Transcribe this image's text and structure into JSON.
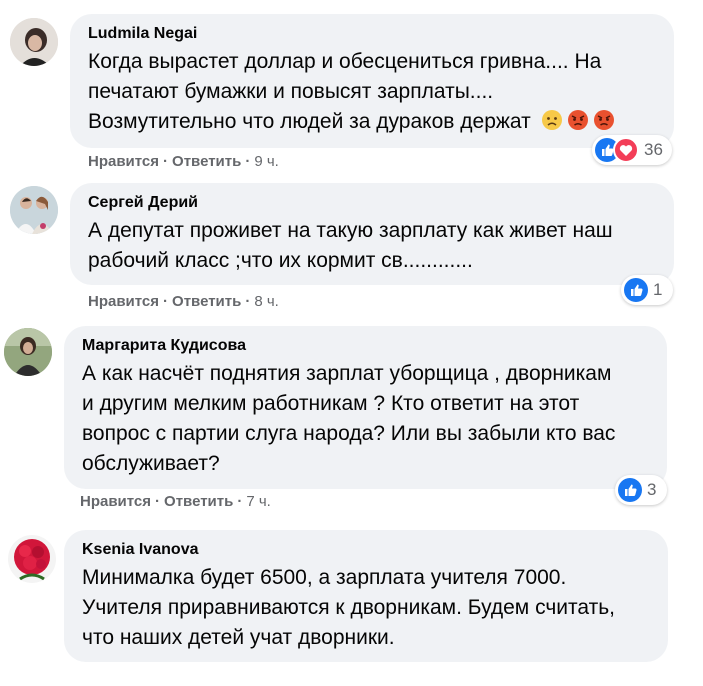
{
  "comments": [
    {
      "author": "Ludmila Negai",
      "lines": [
        "Когда вырастет доллар и обесцениться гривна.... На",
        "печатают бумажки и повысят зарплаты....",
        "Возмутительно что людей за дураков держат"
      ],
      "like": "Нравится",
      "reply": "Ответить",
      "time": "9 ч.",
      "reactions": "36"
    },
    {
      "author": "Сергей Дерий",
      "lines": [
        "А депутат проживет на такую зарплату как живет наш",
        "рабочий класс ;что их кормит св............"
      ],
      "like": "Нравится",
      "reply": "Ответить",
      "time": "8 ч.",
      "reactions": "1"
    },
    {
      "author": "Маргарита Кудисова",
      "lines": [
        "А как насчёт поднятия зарплат уборщица , дворникам",
        "и другим мелким работникам ? Кто ответит на этот",
        "вопрос с партии слуга народа? Или вы забыли кто вас",
        "обслуживает?"
      ],
      "like": "Нравится",
      "reply": "Ответить",
      "time": "7 ч.",
      "reactions": "3"
    },
    {
      "author": "Ksenia Ivanova",
      "lines": [
        "Минималка будет 6500, а зарплата учителя 7000.",
        "Учителя приравниваются к дворникам. Будем считать,",
        "что наших детей учат дворники."
      ]
    }
  ],
  "icons": {
    "like": "like-icon",
    "love": "love-icon",
    "sad": "sad-emoji-icon",
    "angry": "angry-emoji-icon"
  },
  "colors": {
    "bubble": "#f0f2f5",
    "meta_text": "#65676b",
    "like_blue": "#1877f2",
    "love_red": "#f33e58"
  }
}
